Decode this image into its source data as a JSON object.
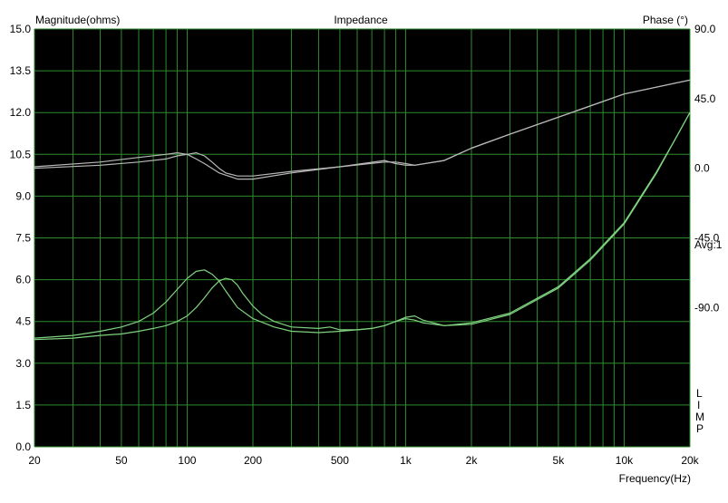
{
  "chart_data": {
    "type": "line",
    "title": "Impedance",
    "y_left_label": "Magnitude(ohms)",
    "y_right_label": "Phase (°)",
    "xlabel": "Frequency(Hz)",
    "x_scale": "log",
    "xlim": [
      20,
      20000
    ],
    "ylim_left": [
      0,
      15
    ],
    "ylim_right": [
      -180,
      90
    ],
    "grid": true,
    "x_ticks": [
      20,
      50,
      100,
      200,
      500,
      1000,
      2000,
      5000,
      10000,
      20000
    ],
    "x_tick_labels": [
      "20",
      "50",
      "100",
      "200",
      "500",
      "1k",
      "2k",
      "5k",
      "10k",
      "20k"
    ],
    "y_left_ticks": [
      0,
      1.5,
      3,
      4.5,
      6,
      7.5,
      9,
      10.5,
      12,
      13.5,
      15
    ],
    "y_left_tick_labels": [
      "0.0",
      "1.5",
      "3.0",
      "4.5",
      "6.0",
      "7.5",
      "9.0",
      "10.5",
      "12.0",
      "13.5",
      "15.0"
    ],
    "y_right_ticks": [
      90,
      45,
      0,
      -45,
      -90
    ],
    "y_right_tick_labels": [
      "90.0",
      "45.0",
      "0.0",
      "-45.0",
      "-90.0"
    ],
    "annotations": [
      "Avg:1"
    ],
    "side_letters": [
      "L",
      "I",
      "M",
      "P"
    ],
    "colors": {
      "background": "#000000",
      "grid": "#2e8b2e",
      "impedance": "#7fd27f",
      "phase": "#b8b8b8"
    },
    "series": [
      {
        "kind": "impedance",
        "x": [
          20,
          30,
          40,
          50,
          60,
          70,
          80,
          90,
          100,
          110,
          120,
          130,
          140,
          150,
          170,
          200,
          250,
          300,
          400,
          500,
          600,
          700,
          800,
          900,
          1000,
          1100,
          1200,
          1500,
          2000,
          3000,
          5000,
          7000,
          10000,
          14000,
          17000,
          20000
        ],
        "y": [
          3.9,
          4.0,
          4.15,
          4.3,
          4.5,
          4.8,
          5.2,
          5.65,
          6.05,
          6.3,
          6.35,
          6.2,
          5.95,
          5.6,
          5.0,
          4.6,
          4.3,
          4.15,
          4.1,
          4.15,
          4.2,
          4.25,
          4.35,
          4.5,
          4.6,
          4.55,
          4.45,
          4.35,
          4.4,
          4.75,
          5.7,
          6.7,
          8.0,
          9.8,
          11.0,
          12.0
        ]
      },
      {
        "kind": "impedance",
        "x": [
          20,
          30,
          40,
          50,
          60,
          70,
          80,
          90,
          100,
          110,
          120,
          130,
          140,
          150,
          160,
          170,
          180,
          200,
          220,
          250,
          300,
          400,
          450,
          500,
          600,
          700,
          800,
          900,
          1000,
          1100,
          1200,
          1500,
          2000,
          3000,
          5000,
          7000,
          10000,
          14000,
          17000,
          20000
        ],
        "y": [
          3.85,
          3.9,
          4.0,
          4.05,
          4.15,
          4.25,
          4.35,
          4.5,
          4.7,
          5.0,
          5.35,
          5.7,
          5.95,
          6.05,
          6.0,
          5.8,
          5.5,
          5.05,
          4.75,
          4.5,
          4.3,
          4.25,
          4.3,
          4.2,
          4.2,
          4.25,
          4.35,
          4.5,
          4.65,
          4.7,
          4.55,
          4.35,
          4.45,
          4.8,
          5.75,
          6.75,
          8.05,
          9.85,
          11.0,
          12.0
        ]
      },
      {
        "kind": "phase",
        "x": [
          20,
          40,
          60,
          80,
          90,
          100,
          110,
          120,
          140,
          170,
          200,
          300,
          500,
          800,
          900,
          1000,
          1100,
          1500,
          2000,
          3000,
          5000,
          10000,
          20000
        ],
        "y": [
          1,
          4,
          7,
          9,
          10,
          9,
          6,
          3,
          -3,
          -7,
          -7,
          -3,
          1,
          5,
          3,
          2,
          2,
          5,
          13,
          22,
          33,
          48,
          57
        ]
      },
      {
        "kind": "phase",
        "x": [
          20,
          40,
          60,
          80,
          90,
          100,
          110,
          120,
          130,
          140,
          150,
          170,
          200,
          300,
          500,
          800,
          900,
          1000,
          1100,
          1500,
          2000,
          3000,
          5000,
          10000,
          20000
        ],
        "y": [
          0,
          2,
          4,
          6,
          8,
          9,
          10,
          8,
          4,
          0,
          -3,
          -5,
          -5,
          -2,
          1,
          4,
          4,
          3,
          2,
          5,
          13,
          22,
          33,
          48,
          57
        ]
      }
    ]
  }
}
